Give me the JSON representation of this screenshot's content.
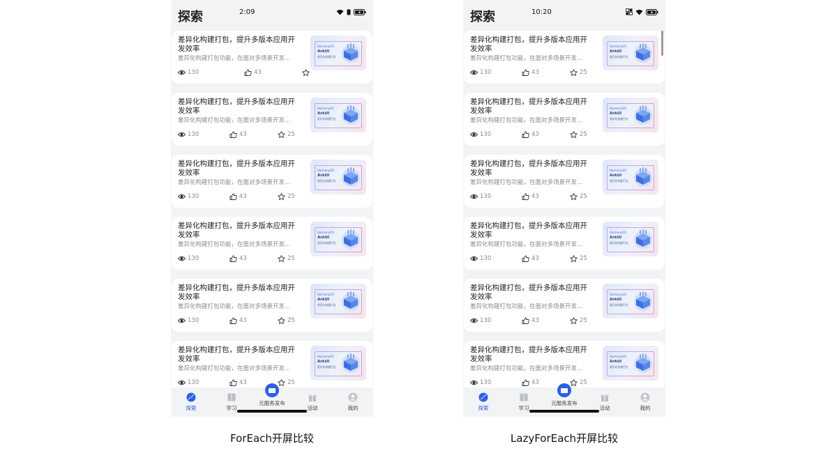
{
  "icon_names": {
    "view": "eye-icon",
    "like": "thumbs-up-icon",
    "favorite": "star-icon",
    "wifi": "wifi-icon",
    "sim": "sim-card-icon",
    "battery": "battery-charging-icon",
    "nfc": "nfc-icon"
  },
  "colors": {
    "accent": "#2b61e6",
    "background": "#f1f3f5",
    "card": "#ffffff"
  },
  "screens": [
    {
      "page_title": "探索",
      "time": "2:09",
      "cards": [
        {
          "title": "差异化构建打包，提升多版本应用开发效率",
          "subtitle": "差异化构建打包功能，在面对多场景开发…",
          "views": "130",
          "likes": "43",
          "stars": ""
        },
        {
          "title": "差异化构建打包，提升多版本应用开发效率",
          "subtitle": "差异化构建打包功能，在面对多场景开发…",
          "views": "130",
          "likes": "43",
          "stars": "25"
        },
        {
          "title": "差异化构建打包，提升多版本应用开发效率",
          "subtitle": "差异化构建打包功能，在面对多场景开发…",
          "views": "130",
          "likes": "43",
          "stars": "25"
        },
        {
          "title": "差异化构建打包，提升多版本应用开发效率",
          "subtitle": "差异化构建打包功能，在面对多场景开发…",
          "views": "130",
          "likes": "43",
          "stars": "25"
        },
        {
          "title": "差异化构建打包，提升多版本应用开发效率",
          "subtitle": "差异化构建打包功能，在面对多场景开发…",
          "views": "130",
          "likes": "43",
          "stars": "25"
        },
        {
          "title": "差异化构建打包，提升多版本应用开发效率",
          "subtitle": "差异化构建打包功能，在面对多场景开发…",
          "views": "130",
          "likes": "43",
          "stars": "25"
        }
      ],
      "thumb": {
        "top": "HarmonyOS",
        "title": "ArkUI",
        "sub": "差异化构建打包"
      },
      "tabs": [
        "探索",
        "学习",
        "活动",
        "我的"
      ],
      "center_tab_label": "元服务发布",
      "caption": "ForEach开屏比较"
    },
    {
      "page_title": "探索",
      "time": "10:20",
      "cards": [
        {
          "title": "差异化构建打包，提升多版本应用开发效率",
          "subtitle": "差异化构建打包功能，在面对多场景开发…",
          "views": "130",
          "likes": "43",
          "stars": "25"
        },
        {
          "title": "差异化构建打包，提升多版本应用开发效率",
          "subtitle": "差异化构建打包功能，在面对多场景开发…",
          "views": "130",
          "likes": "43",
          "stars": "25"
        },
        {
          "title": "差异化构建打包，提升多版本应用开发效率",
          "subtitle": "差异化构建打包功能，在面对多场景开发…",
          "views": "130",
          "likes": "43",
          "stars": "25"
        },
        {
          "title": "差异化构建打包，提升多版本应用开发效率",
          "subtitle": "差异化构建打包功能，在面对多场景开发…",
          "views": "130",
          "likes": "43",
          "stars": "25"
        },
        {
          "title": "差异化构建打包，提升多版本应用开发效率",
          "subtitle": "差异化构建打包功能，在面对多场景开发…",
          "views": "130",
          "likes": "43",
          "stars": "25"
        },
        {
          "title": "差异化构建打包，提升多版本应用开发效率",
          "subtitle": "差异化构建打包功能，在面对多场景开发…",
          "views": "130",
          "likes": "43",
          "stars": "25"
        }
      ],
      "thumb": {
        "top": "HarmonyOS",
        "title": "ArkUI",
        "sub": "差异化构建打包"
      },
      "tabs": [
        "探索",
        "学习",
        "活动",
        "我的"
      ],
      "center_tab_label": "元服务发布",
      "caption": "LazyForEach开屏比较"
    }
  ]
}
